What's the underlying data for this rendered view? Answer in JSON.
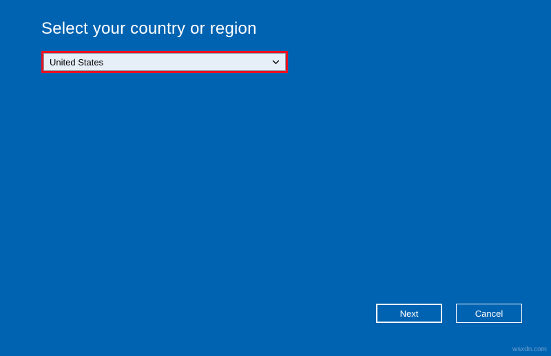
{
  "heading": "Select your country or region",
  "dropdown": {
    "selected": "United States"
  },
  "buttons": {
    "next": "Next",
    "cancel": "Cancel"
  },
  "watermark": "wsxdn.com"
}
